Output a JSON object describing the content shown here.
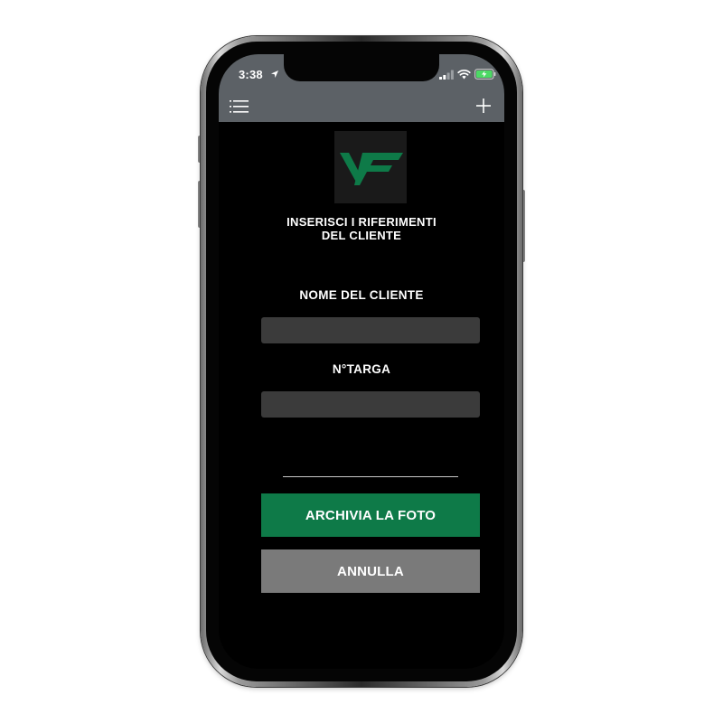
{
  "status_bar": {
    "time": "3:38"
  },
  "header": {
    "menu_icon": "list-menu-icon",
    "add_icon": "plus-icon"
  },
  "logo": {
    "icon": "vf-logo",
    "colors": {
      "green": "#0e7a48",
      "background": "#1a1a1a"
    }
  },
  "form": {
    "title_line1": "INSERISCI I RIFERIMENTI",
    "title_line2": "DEL CLIENTE",
    "client_name_label": "NOME DEL CLIENTE",
    "client_name_value": "",
    "plate_label": "N°TARGA",
    "plate_value": ""
  },
  "actions": {
    "archive_label": "ARCHIVIA LA FOTO",
    "cancel_label": "ANNULLA"
  },
  "colors": {
    "header_bg": "#5c6166",
    "screen_bg": "#000000",
    "input_bg": "#3b3b3b",
    "primary_button": "#0e7a48",
    "secondary_button": "#7a7a7a"
  }
}
